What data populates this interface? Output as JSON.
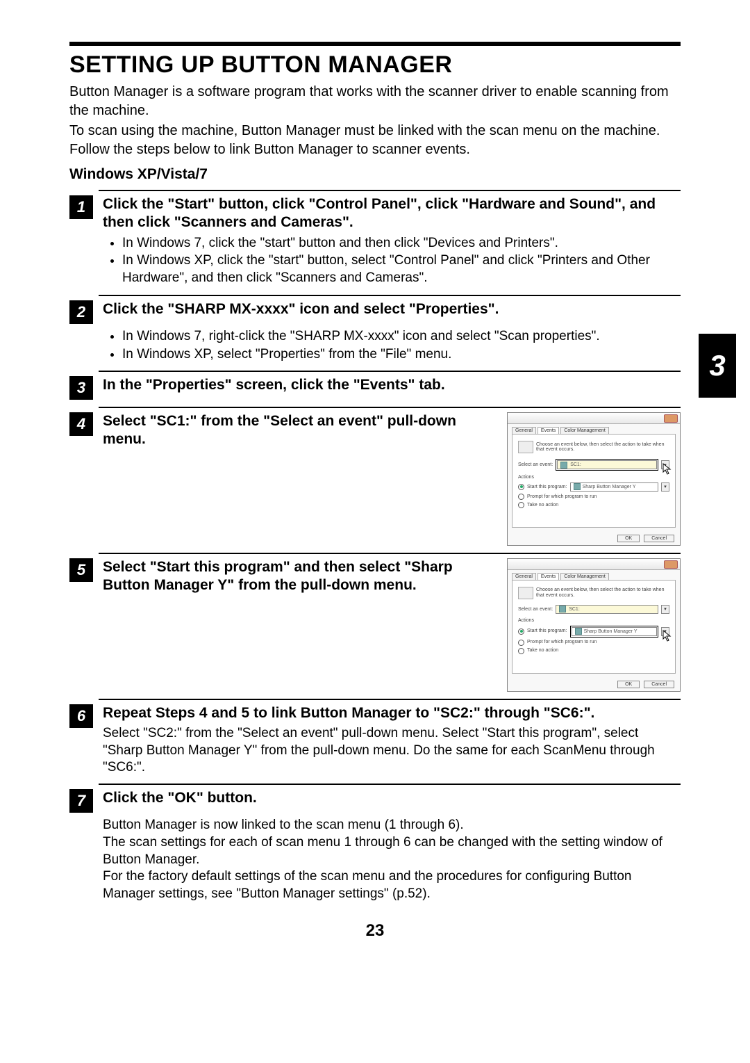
{
  "title": "SETTING UP BUTTON MANAGER",
  "intro_p1": "Button Manager is a software program that works with the scanner driver to enable scanning from the machine.",
  "intro_p2": "To scan using the machine, Button Manager must be linked with the scan menu on the machine. Follow the steps below to link Button Manager to scanner events.",
  "os_heading": "Windows XP/Vista/7",
  "chapter_tab": "3",
  "page_number": "23",
  "steps": {
    "s1": {
      "num": "1",
      "title": "Click the \"Start\" button, click \"Control Panel\", click \"Hardware and Sound\", and then click \"Scanners and Cameras\".",
      "b1": "In Windows 7, click the \"start\" button and then click \"Devices and Printers\".",
      "b2": "In Windows XP, click the \"start\" button, select \"Control Panel\" and click \"Printers and Other Hardware\", and then click \"Scanners and Cameras\"."
    },
    "s2": {
      "num": "2",
      "title": "Click the \"SHARP MX-xxxx\" icon and select \"Properties\".",
      "b1": "In Windows 7, right-click the \"SHARP MX-xxxx\" icon and select \"Scan properties\".",
      "b2": "In Windows XP, select \"Properties\" from the \"File\" menu."
    },
    "s3": {
      "num": "3",
      "title": "In the \"Properties\" screen, click the \"Events\" tab."
    },
    "s4": {
      "num": "4",
      "title": "Select \"SC1:\" from the \"Select an event\" pull-down menu."
    },
    "s5": {
      "num": "5",
      "title": "Select \"Start this program\" and then select \"Sharp Button Manager Y\" from the pull-down menu."
    },
    "s6": {
      "num": "6",
      "title": "Repeat Steps 4 and 5 to link Button Manager to \"SC2:\" through \"SC6:\".",
      "sub": "Select \"SC2:\" from the \"Select an event\" pull-down menu. Select \"Start this program\", select \"Sharp Button Manager Y\" from the pull-down menu. Do the same for each ScanMenu through \"SC6:\"."
    },
    "s7": {
      "num": "7",
      "title": "Click the \"OK\" button.",
      "sub1": "Button Manager is now linked to the scan menu (1 through 6).",
      "sub2": "The scan settings for each of scan menu 1 through 6 can be changed with the setting window of Button Manager.",
      "sub3": "For the factory default settings of the scan menu and the procedures for configuring Button Manager settings, see \"Button Manager settings\" (p.52)."
    }
  },
  "dialog": {
    "tab_general": "General",
    "tab_events": "Events",
    "tab_color": "Color Management",
    "hint": "Choose an event below, then select the action to take when that event occurs.",
    "select_event_label": "Select an event:",
    "event_value": "SC1:",
    "actions_label": "Actions",
    "radio_start": "Start this program:",
    "program_value": "Sharp Button Manager Y",
    "radio_prompt": "Prompt for which program to run",
    "radio_none": "Take no action",
    "ok": "OK",
    "cancel": "Cancel"
  }
}
